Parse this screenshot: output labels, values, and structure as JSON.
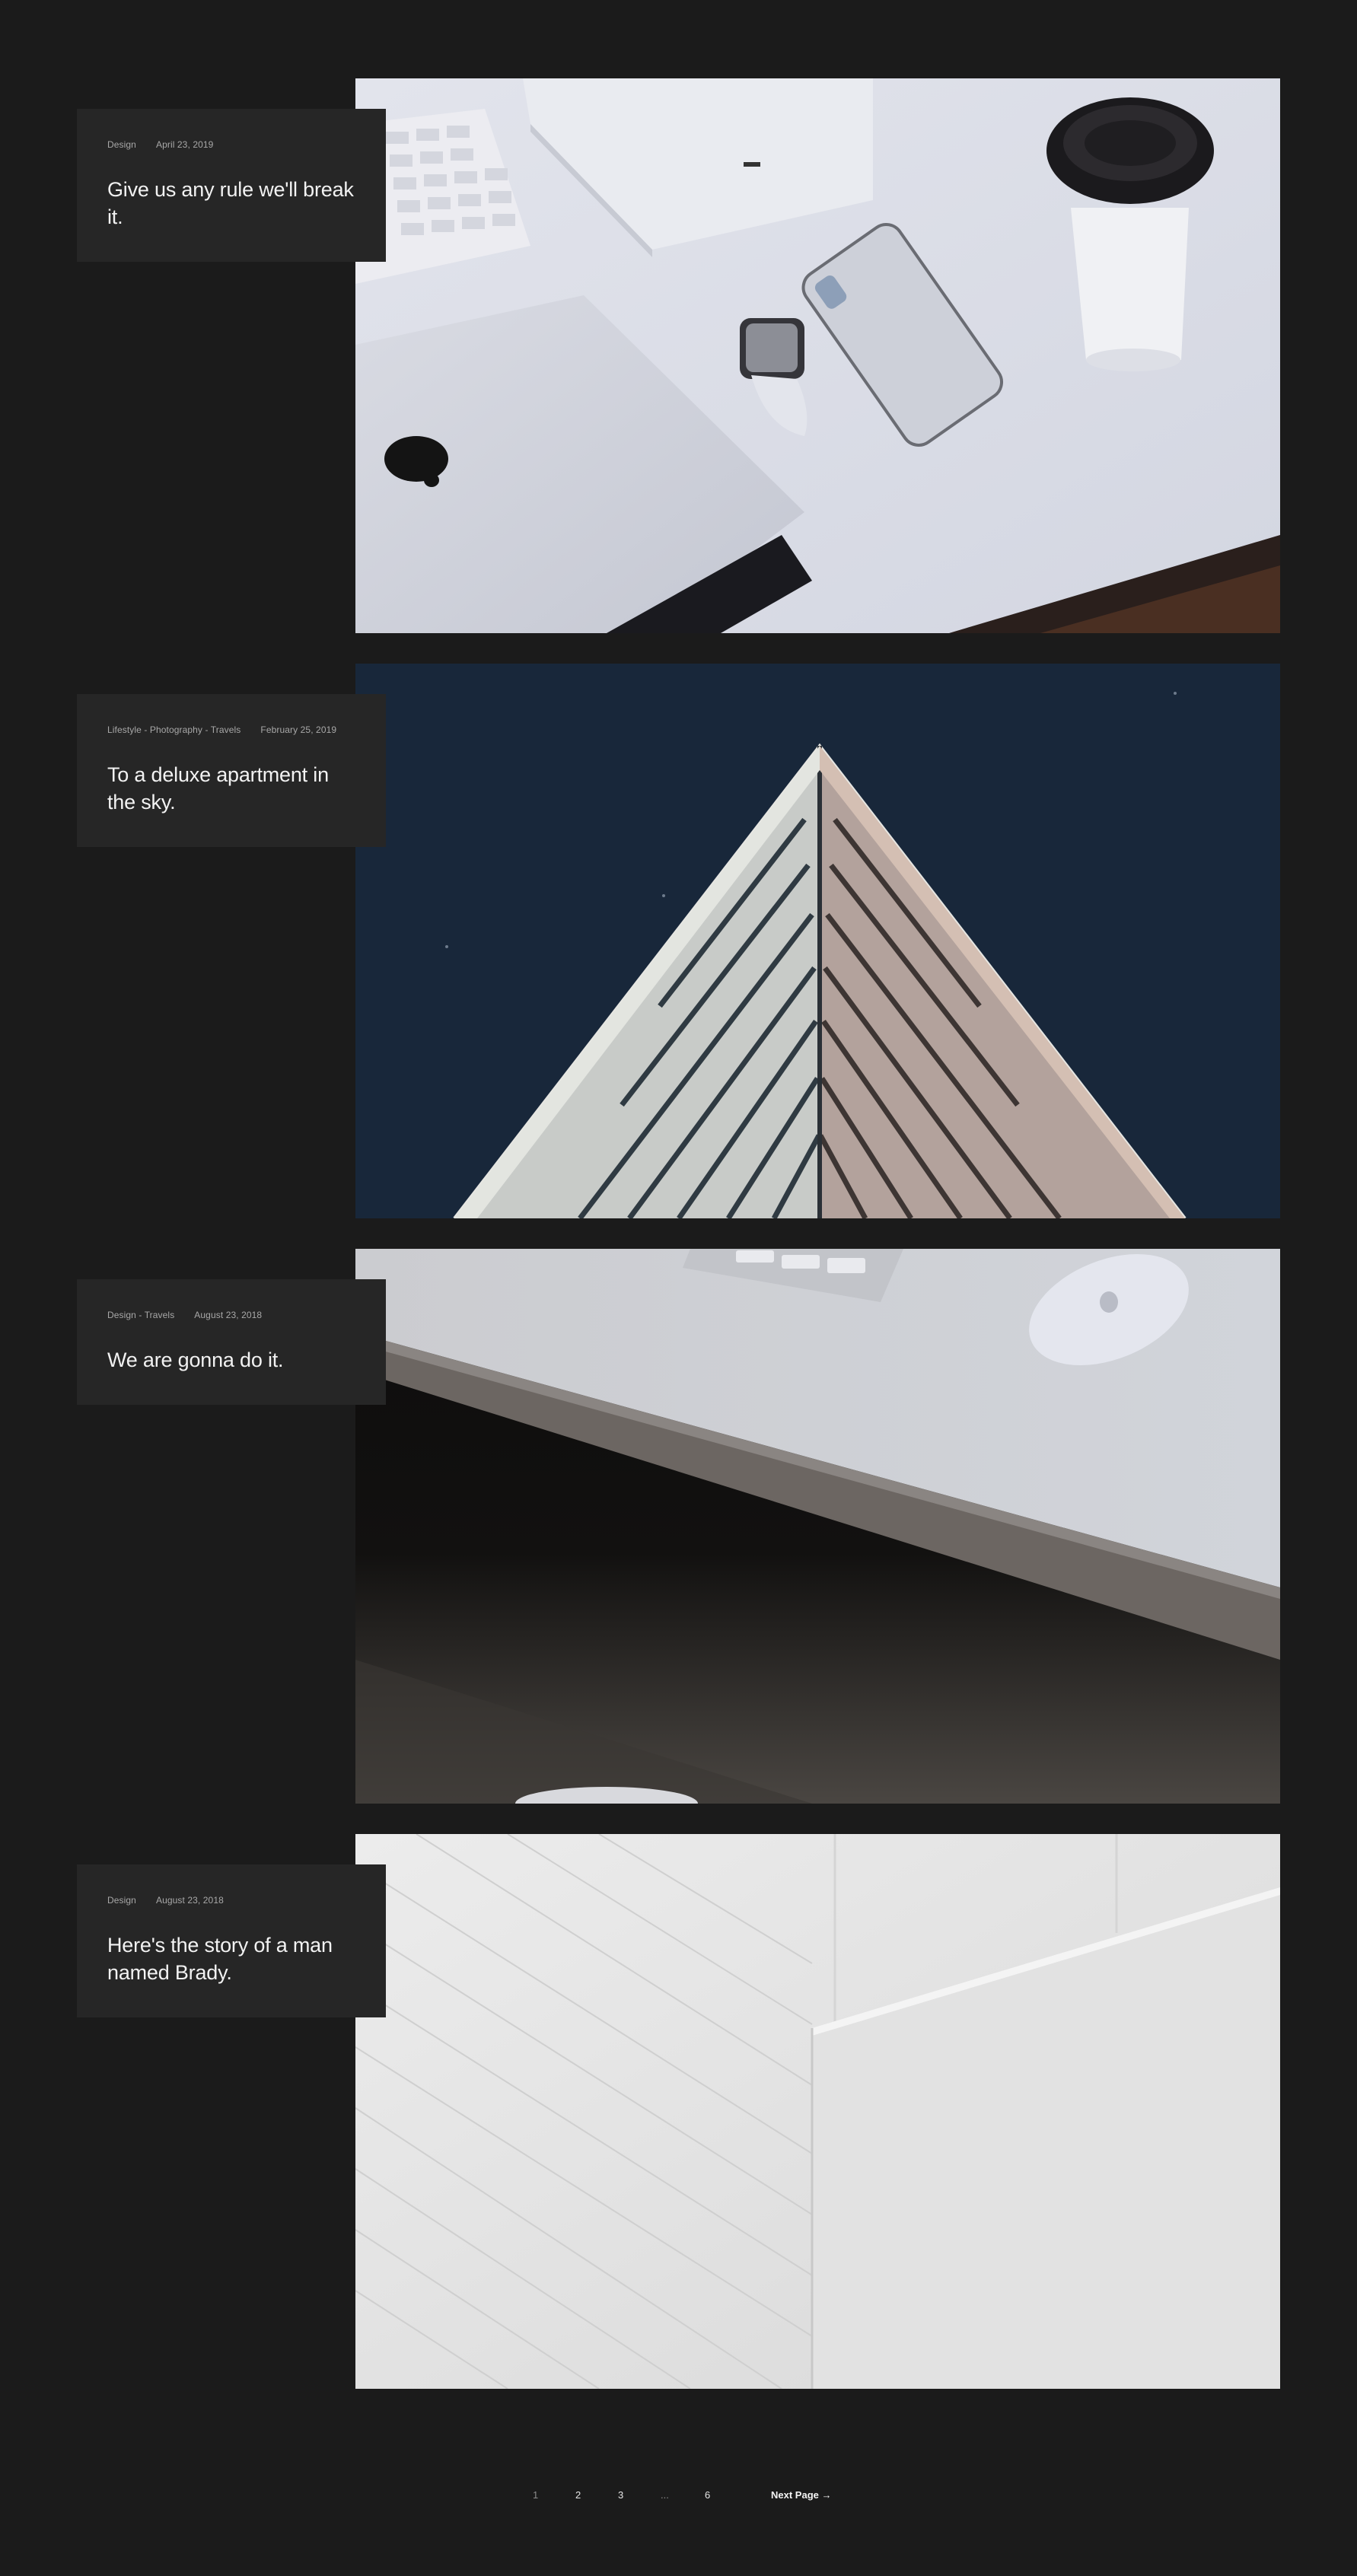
{
  "posts": [
    {
      "categories": "Design",
      "date": "April 23, 2019",
      "title": "Give us any rule we'll break it.",
      "image": "desk-with-laptop-watch-phone-coffee"
    },
    {
      "categories": "Lifestyle - Photography - Travels",
      "date": "February 25, 2019",
      "title": "To a deluxe apartment in the sky.",
      "image": "triangular-building-night-sky"
    },
    {
      "categories": "Design - Travels",
      "date": "August 23, 2018",
      "title": "We are gonna do it.",
      "image": "desk-edge-keyboard-mouse"
    },
    {
      "categories": "Design",
      "date": "August 23, 2018",
      "title": "Here's the story of a man named Brady.",
      "image": "white-architecture-abstract"
    }
  ],
  "pagination": {
    "pages": [
      "1",
      "2",
      "3",
      "...",
      "6"
    ],
    "current": "1",
    "next_label": "Next Page →"
  },
  "colors": {
    "background": "#1b1b1b",
    "card": "#262626",
    "text": "#f2f2f2",
    "meta": "#a8a8a8"
  }
}
